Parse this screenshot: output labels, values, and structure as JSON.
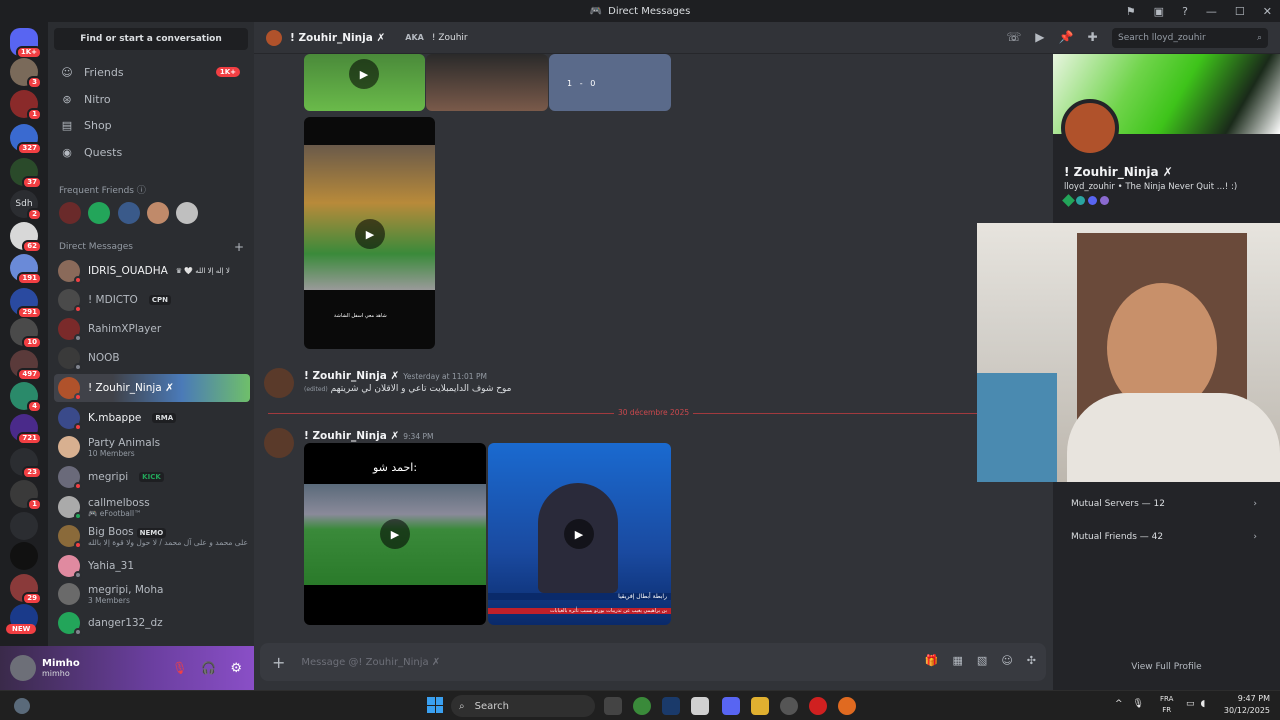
{
  "window": {
    "title": "Direct Messages"
  },
  "servers": {
    "home_badge": "1K+",
    "badges": [
      "3",
      "1",
      "327",
      "37",
      "2",
      "62",
      "191",
      "291",
      "10",
      "497",
      "4",
      "721",
      "23",
      "1",
      "29"
    ],
    "sdh_label": "Sdh",
    "new_label": "NEW"
  },
  "sidebar": {
    "find_label": "Find or start a conversation",
    "nav": [
      {
        "label": "Friends",
        "badge": "1K+"
      },
      {
        "label": "Nitro"
      },
      {
        "label": "Shop"
      },
      {
        "label": "Quests"
      }
    ],
    "frequent_label": "Frequent Friends",
    "dm_label": "Direct Messages",
    "dms": [
      {
        "name": "IDRIS_OUADHA",
        "extra": "♛ 🤍 لا إله إلا الله"
      },
      {
        "name": "! MDICTO",
        "tag": "CPN"
      },
      {
        "name": "RahimXPlayer"
      },
      {
        "name": "NOOB"
      },
      {
        "name": "! Zouhir_Ninja ✗"
      },
      {
        "name": "K.mbappe",
        "tag": "RMA"
      },
      {
        "name": "Party Animals",
        "sub": "10 Members"
      },
      {
        "name": "megripi",
        "tag": "KICK"
      },
      {
        "name": "callmelboss",
        "sub": "🎮 eFootball™"
      },
      {
        "name": "Big Boos",
        "tag": "NEMO",
        "sub": "اللهم صل على محمد و على آل محمد / لا حول ولا قوة إلا بالله"
      },
      {
        "name": "Yahia_31"
      },
      {
        "name": "megripi, Moha",
        "sub": "3 Members"
      },
      {
        "name": "danger132_dz"
      }
    ]
  },
  "userbar": {
    "name": "Mimho",
    "username": "mimho"
  },
  "header": {
    "name": "! Zouhir_Ninja ✗",
    "aka_label": "AKA",
    "aka_value": "! Zouhir",
    "search_placeholder": "Search lloyd_zouhir"
  },
  "messages": [
    {
      "author": "! Zouhir_Ninja ✗",
      "time": "Yesterday at 11:01 PM",
      "edited": "(edited)",
      "text": "موح شوف الدايمبلايت تاعي و الاقلان لي شريتهم"
    },
    {
      "author": "! Zouhir_Ninja ✗",
      "time": "9:34 PM",
      "caption": "احمد شو:"
    }
  ],
  "date_divider": "30 décembre 2025",
  "media": {
    "score_left": "1",
    "score_sep": "-",
    "score_right": "0",
    "caption_small": "شاهد معي اسفل الشاشة",
    "news_banner": "رابطة أبطال إفريقيا",
    "news_ticker": "بن براهيمي يغيب عن تدريبات بورتو بسبب تأثره بالغيابات"
  },
  "composer": {
    "placeholder": "Message @! Zouhir_Ninja ✗"
  },
  "profile": {
    "name": "! Zouhir_Ninja ✗",
    "handle": "lloyd_zouhir",
    "bio": "The Ninja Never Quit ...! :)",
    "mutual_servers": "Mutual Servers — 12",
    "mutual_friends": "Mutual Friends — 42",
    "view_full": "View Full Profile"
  },
  "taskbar": {
    "search_label": "Search",
    "lang1": "FRA",
    "lang2": "FR",
    "time": "9:47 PM",
    "date": "30/12/2025"
  },
  "colors": {
    "accent": "#5865f2",
    "danger": "#f23f43",
    "online": "#23a55a",
    "dnd": "#f23f43",
    "background": "#313338"
  }
}
